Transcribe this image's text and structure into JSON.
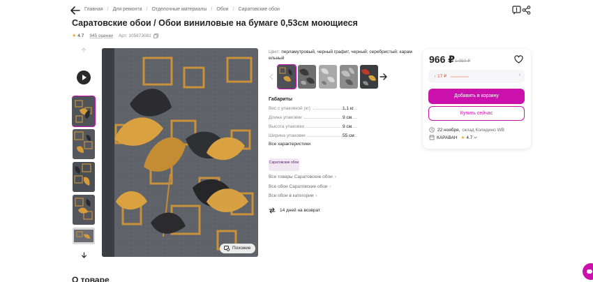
{
  "breadcrumbs": [
    "Главная",
    "Для ремонта",
    "Отделочные материалы",
    "Обои",
    "Саратовские обои"
  ],
  "product": {
    "title": "Саратовские обои / Обои виниловые на бумаге 0,53см моющиеся",
    "rating": "4.7",
    "reviews": "945 оценки",
    "article": "Арт: 105873081"
  },
  "media": {
    "similar_label": "Похожие"
  },
  "color": {
    "label": "Цвет:",
    "value": "перламутровый, черный графит, черный; серебристый; карам ельный"
  },
  "specs": {
    "title": "Габариты",
    "rows": [
      {
        "name": "Вес с упаковкой (кг)",
        "value": "1,1 кг"
      },
      {
        "name": "Длина упаковки",
        "value": "9 см"
      },
      {
        "name": "Высота упаковки",
        "value": "9 см"
      },
      {
        "name": "Ширина упаковки",
        "value": "55 см"
      }
    ],
    "all_link": "Все характеристики"
  },
  "brand": {
    "badge": "Саратовские обои",
    "links": [
      "Все товары Саратовские обои",
      "Все обои Саратовские обои",
      "Все обои в категории"
    ],
    "return_policy": "14 дней на возврат"
  },
  "buy_card": {
    "price": "966 ₽",
    "old_price": "1 050 ₽",
    "price_change": "↑ 17 ₽",
    "add_to_cart": "Добавить в корзину",
    "buy_now": "Купить сейчас",
    "delivery_date": "22 ноября,",
    "delivery_warehouse": "склад Коледино WB",
    "seller_name": "КАРАВАН",
    "seller_rating": "4.7"
  },
  "about_title": "О товаре",
  "colors": {
    "accent": "#cb11ab",
    "price_up": "#f55123",
    "star": "#f1a832"
  }
}
